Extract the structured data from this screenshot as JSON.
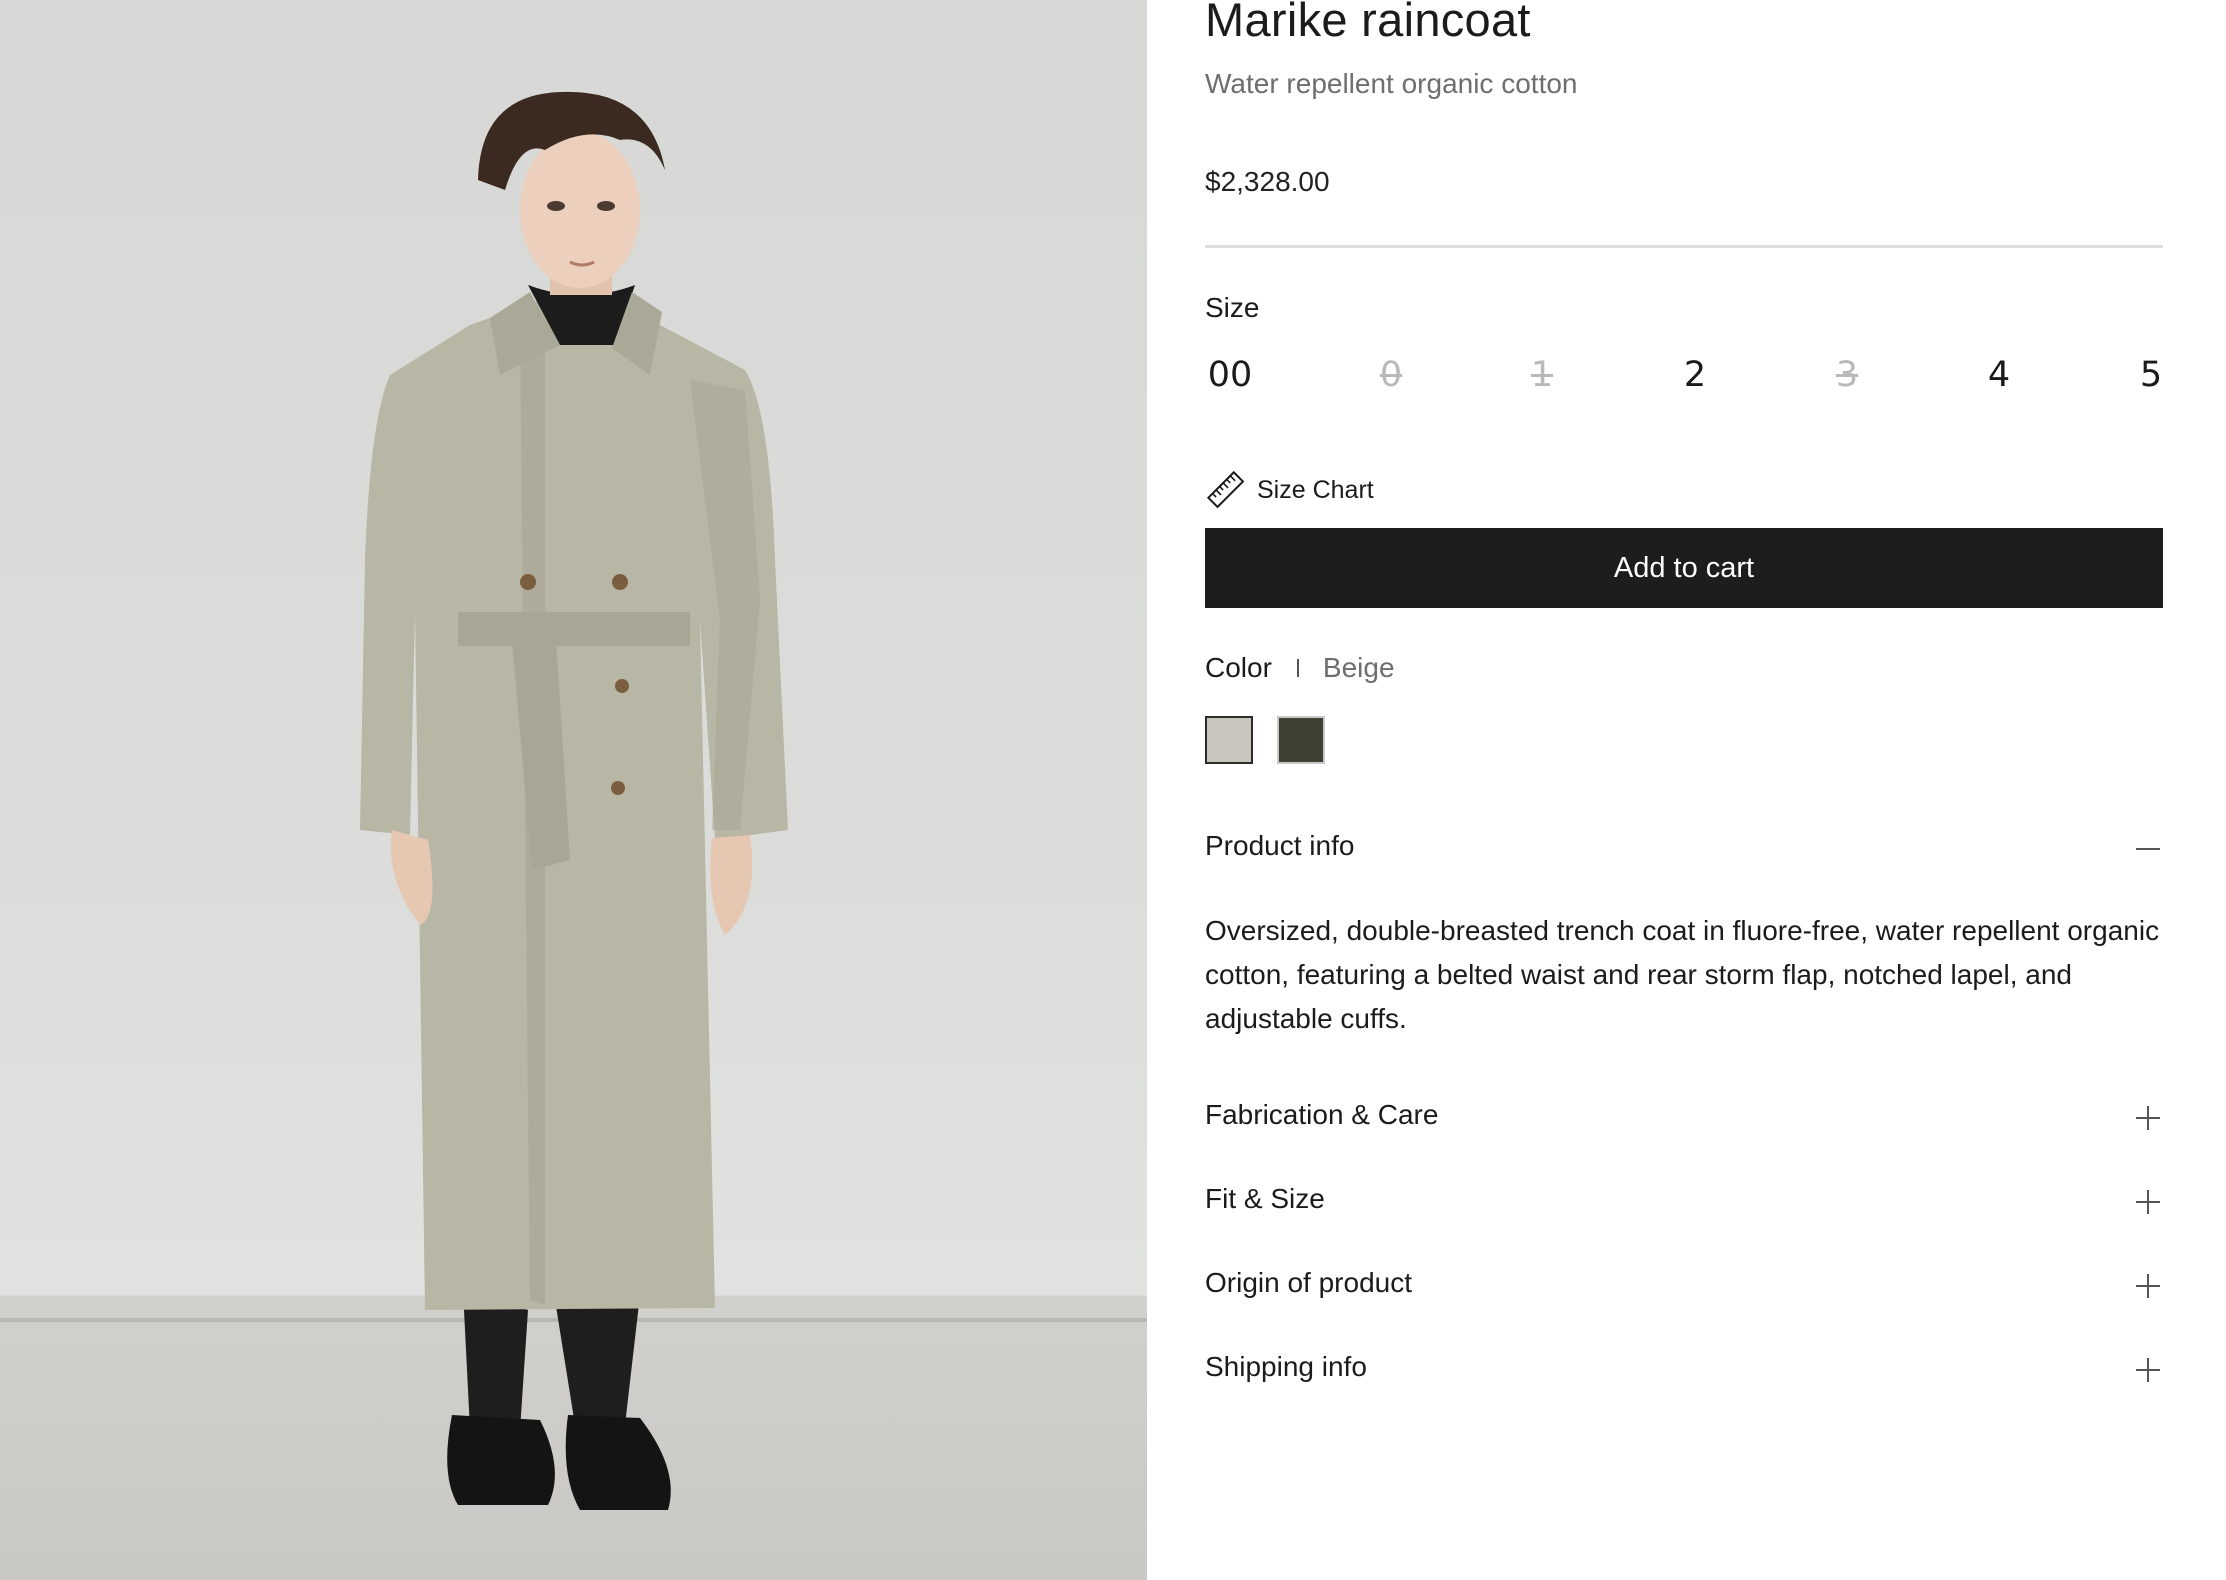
{
  "product": {
    "title": "Marike raincoat",
    "subtitle": "Water repellent organic cotton",
    "price": "$2,328.00"
  },
  "size": {
    "label": "Size",
    "options": [
      {
        "label": "00",
        "available": true
      },
      {
        "label": "0",
        "available": false
      },
      {
        "label": "1",
        "available": false
      },
      {
        "label": "2",
        "available": true
      },
      {
        "label": "3",
        "available": false
      },
      {
        "label": "4",
        "available": true
      },
      {
        "label": "5",
        "available": true
      }
    ],
    "chart_label": "Size Chart"
  },
  "cart": {
    "label": "Add to cart"
  },
  "color": {
    "label": "Color",
    "selected": "Beige",
    "swatches": [
      {
        "name": "Beige",
        "hex": "#c9c6bd",
        "selected": true
      },
      {
        "name": "Olive",
        "hex": "#3e4132",
        "selected": false
      }
    ]
  },
  "accordion": {
    "product_info": {
      "label": "Product info",
      "expanded": true,
      "body": "Oversized, double-breasted trench coat in fluore-free, water repellent organic cotton, featuring a belted waist and rear storm flap, notched lapel, and adjustable cuffs."
    },
    "fabrication": {
      "label": "Fabrication & Care",
      "expanded": false
    },
    "fit": {
      "label": "Fit & Size",
      "expanded": false
    },
    "origin": {
      "label": "Origin of product",
      "expanded": false
    },
    "shipping": {
      "label": "Shipping info",
      "expanded": false
    }
  },
  "icons": {
    "size_chart": "ruler-icon",
    "collapse": "minus-icon",
    "expand": "plus-icon"
  },
  "colors": {
    "button_bg": "#1d1d1d",
    "muted_text": "#6e6e6e",
    "unavailable_size": "#b9b9b9",
    "divider": "#dedede"
  }
}
